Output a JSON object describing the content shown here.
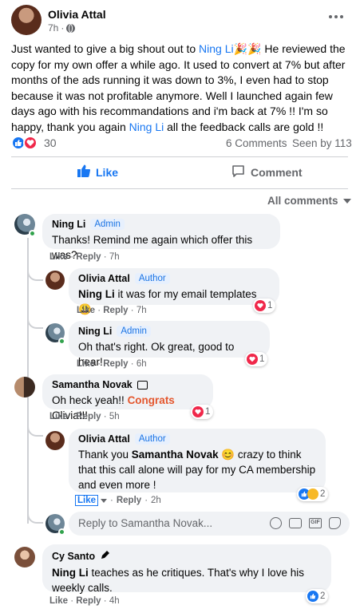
{
  "post": {
    "author": "Olivia Attal",
    "time": "7h",
    "separator": "·",
    "text_1": "Just wanted to give a big shout out to ",
    "mention_1": "Ning Li",
    "text_2": " He reviewed the copy for my own offer a while ago. It used to convert at 7% but after months of the ads running it was down to 3%, I even had to stop because it was not profitable anymore. Well I launched again few days ago with his recommandations and i'm back at 7% !! I'm so happy, thank you again ",
    "mention_2": "Ning Li",
    "text_3": " all the feedback calls are gold !!",
    "reactions_count": "30",
    "comments_count": "6 Comments",
    "seen_by": "Seen by 113"
  },
  "actions": {
    "like": "Like",
    "comment": "Comment"
  },
  "filter": {
    "label": "All comments"
  },
  "comments": [
    {
      "author": "Ning Li",
      "badge": "Admin",
      "text": "Thanks! Remind me again which offer this was?",
      "like": "Like",
      "reply": "Reply",
      "time": "7h"
    },
    {
      "author": "Olivia Attal",
      "badge": "Author",
      "mention": "Ning Li",
      "text": " it was for my email templates",
      "like": "Like",
      "reply": "Reply",
      "time": "7h",
      "reaction_count": "1"
    },
    {
      "author": "Ning Li",
      "badge": "Admin",
      "text": "Oh that's right. Ok great, good to hear!",
      "like": "Like",
      "reply": "Reply",
      "time": "6h",
      "reaction_count": "1"
    },
    {
      "author": "Samantha Novak",
      "text_1": "Oh heck yeah!! ",
      "highlight": "Congrats",
      "text_2": " Olivia!!!",
      "like": "Like",
      "reply": "Reply",
      "time": "5h",
      "reaction_count": "1"
    },
    {
      "author": "Olivia Attal",
      "badge": "Author",
      "text_1": "Thank you ",
      "mention": "Samantha Novak",
      "text_2": " crazy to think that this call alone will pay for my CA membership and even more !",
      "like": "Like",
      "reply": "Reply",
      "time": "2h",
      "reaction_count": "2"
    },
    {
      "author": "Cy Santo",
      "mention": "Ning Li",
      "text": " teaches as he critiques. That's why I love his weekly calls.",
      "like": "Like",
      "reply": "Reply",
      "time": "4h",
      "reaction_count": "2"
    }
  ],
  "reply_box": {
    "placeholder": "Reply to Samantha Novak..."
  },
  "colors": {
    "accent": "#1877f2",
    "mention": "#1877f2",
    "highlight": "#e4572e",
    "heart": "#f0284a",
    "bubble": "#f0f2f5"
  }
}
